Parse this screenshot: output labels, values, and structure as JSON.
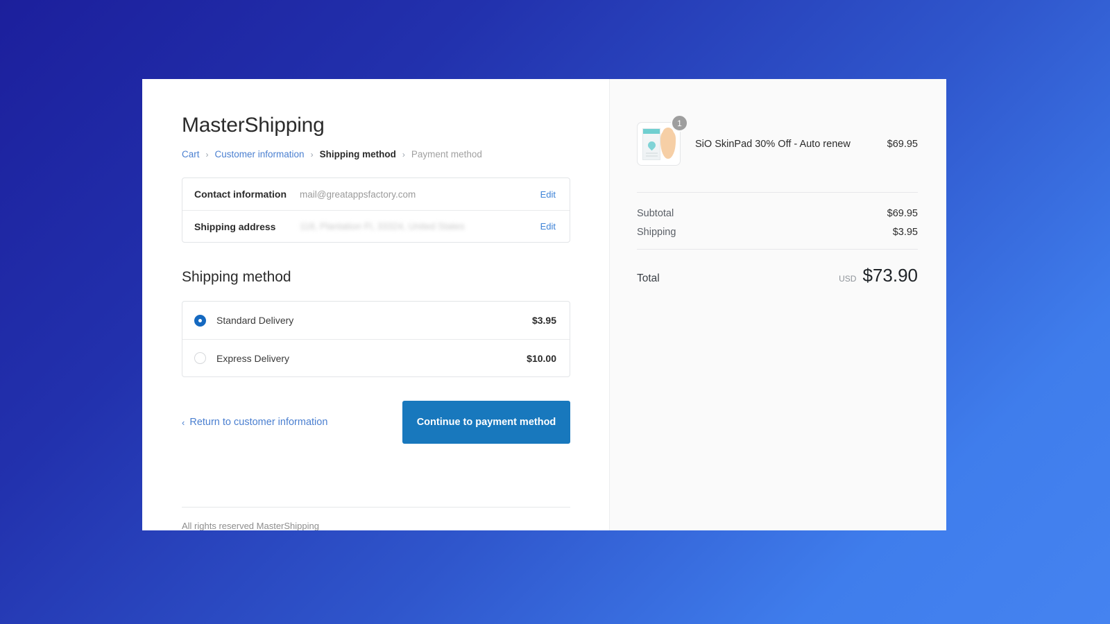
{
  "store": {
    "title": "MasterShipping"
  },
  "breadcrumb": {
    "items": [
      {
        "label": "Cart",
        "state": "link"
      },
      {
        "label": "Customer information",
        "state": "link"
      },
      {
        "label": "Shipping method",
        "state": "current"
      },
      {
        "label": "Payment method",
        "state": "upcoming"
      }
    ],
    "separator": "›"
  },
  "info": {
    "contact": {
      "label": "Contact information",
      "value": "mail@greatappsfactory.com",
      "edit_label": "Edit"
    },
    "address": {
      "label": "Shipping address",
      "value": "118, Plantation Fl, 33324, United States",
      "edit_label": "Edit"
    }
  },
  "shipping": {
    "section_title": "Shipping method",
    "options": [
      {
        "label": "Standard Delivery",
        "price": "$3.95",
        "selected": true
      },
      {
        "label": "Express Delivery",
        "price": "$10.00",
        "selected": false
      }
    ]
  },
  "actions": {
    "return_label": "Return to customer information",
    "return_chevron": "‹",
    "continue_label": "Continue to payment method"
  },
  "footer": {
    "text": "All rights reserved MasterShipping"
  },
  "summary": {
    "product": {
      "name": "SiO SkinPad 30% Off - Auto renew",
      "price": "$69.95",
      "quantity": "1"
    },
    "lines": [
      {
        "label": "Subtotal",
        "amount": "$69.95"
      },
      {
        "label": "Shipping",
        "amount": "$3.95"
      }
    ],
    "total": {
      "label": "Total",
      "currency": "USD",
      "amount": "$73.90"
    }
  },
  "colors": {
    "accent_button": "#1878bd",
    "link": "#4a7fd0",
    "radio_selected": "#1569c0",
    "badge": "#9e9e9e",
    "bg_gradient_start": "#1c1f9c",
    "bg_gradient_end": "#4583f0"
  }
}
